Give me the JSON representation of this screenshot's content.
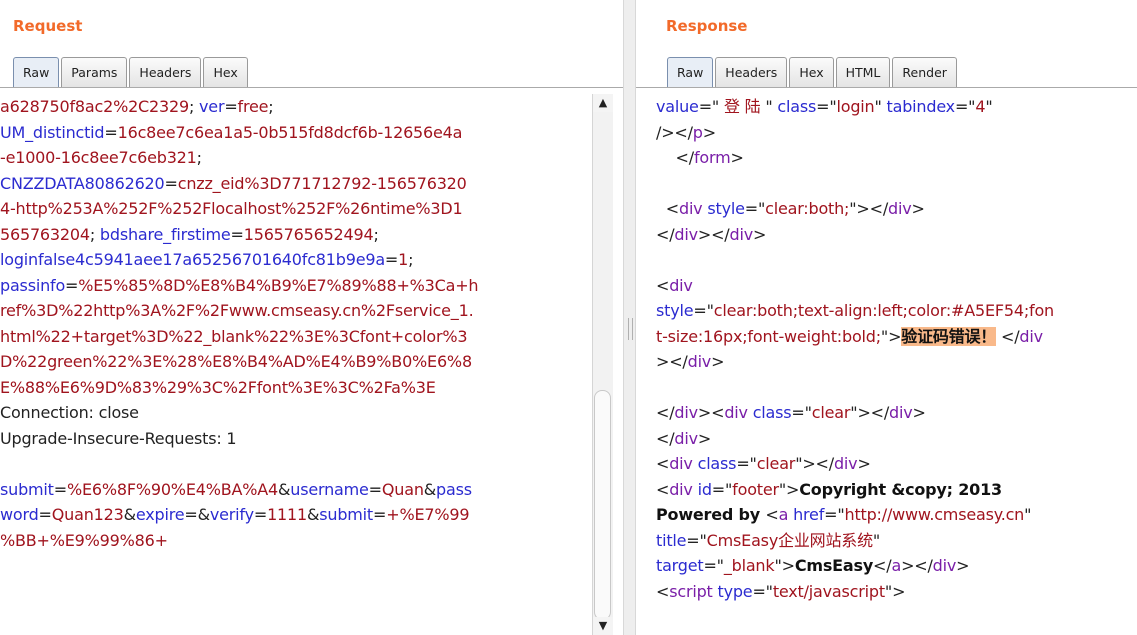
{
  "request": {
    "title": "Request",
    "tabs": [
      "Raw",
      "Params",
      "Headers",
      "Hex"
    ],
    "lines": [
      [
        [
          "v",
          "a628750f8ac2%2C2329"
        ],
        [
          "p",
          "; "
        ],
        [
          "k",
          "ver"
        ],
        [
          "p",
          "="
        ],
        [
          "v",
          "free"
        ],
        [
          "p",
          ";"
        ]
      ],
      [
        [
          "k",
          "UM_distinctid"
        ],
        [
          "p",
          "="
        ],
        [
          "v",
          "16c8ee7c6ea1a5-0b515fd8dcf6b-12656e4a"
        ]
      ],
      [
        [
          "v",
          "-e1000-16c8ee7c6eb321"
        ],
        [
          "p",
          ";"
        ]
      ],
      [
        [
          "k",
          "CNZZDATA80862620"
        ],
        [
          "p",
          "="
        ],
        [
          "v",
          "cnzz_eid%3D771712792-156576320"
        ]
      ],
      [
        [
          "v",
          "4-http%253A%252F%252Flocalhost%252F%26ntime%3D1"
        ]
      ],
      [
        [
          "v",
          "565763204"
        ],
        [
          "p",
          "; "
        ],
        [
          "k",
          "bdshare_firstime"
        ],
        [
          "p",
          "="
        ],
        [
          "v",
          "1565765652494"
        ],
        [
          "p",
          ";"
        ]
      ],
      [
        [
          "k",
          "loginfalse4c5941aee17a65256701640fc81b9e9a"
        ],
        [
          "p",
          "="
        ],
        [
          "v",
          "1"
        ],
        [
          "p",
          ";"
        ]
      ],
      [
        [
          "k",
          "passinfo"
        ],
        [
          "p",
          "="
        ],
        [
          "v",
          "%E5%85%8D%E8%B4%B9%E7%89%88+%3Ca+h"
        ]
      ],
      [
        [
          "v",
          "ref%3D%22http%3A%2F%2Fwww.cmseasy.cn%2Fservice_1."
        ]
      ],
      [
        [
          "v",
          "html%22+target%3D%22_blank%22%3E%3Cfont+color%3"
        ]
      ],
      [
        [
          "v",
          "D%22green%22%3E%28%E8%B4%AD%E4%B9%B0%E6%8"
        ]
      ],
      [
        [
          "v",
          "E%88%E6%9D%83%29%3C%2Ffont%3E%3C%2Fa%3E"
        ]
      ],
      [
        [
          "p",
          "Connection: close"
        ]
      ],
      [
        [
          "p",
          "Upgrade-Insecure-Requests: 1"
        ]
      ],
      [
        [
          "p",
          " "
        ]
      ],
      [
        [
          "k",
          "submit"
        ],
        [
          "p",
          "="
        ],
        [
          "v",
          "%E6%8F%90%E4%BA%A4"
        ],
        [
          "p",
          "&"
        ],
        [
          "k",
          "username"
        ],
        [
          "p",
          "="
        ],
        [
          "v",
          "Quan"
        ],
        [
          "p",
          "&"
        ],
        [
          "k",
          "pass"
        ]
      ],
      [
        [
          "k",
          "word"
        ],
        [
          "p",
          "="
        ],
        [
          "v",
          "Quan123"
        ],
        [
          "p",
          "&"
        ],
        [
          "k",
          "expire"
        ],
        [
          "p",
          "="
        ],
        [
          "p",
          "&"
        ],
        [
          "k",
          "verify"
        ],
        [
          "p",
          "="
        ],
        [
          "v",
          "1111"
        ],
        [
          "p",
          "&"
        ],
        [
          "k",
          "submit"
        ],
        [
          "p",
          "="
        ],
        [
          "v",
          "+%E7%99"
        ]
      ],
      [
        [
          "v",
          "%BB+%E9%99%86+"
        ]
      ]
    ]
  },
  "response": {
    "title": "Response",
    "tabs": [
      "Raw",
      "Headers",
      "Hex",
      "HTML",
      "Render"
    ],
    "lines": [
      [
        [
          "attr",
          "value"
        ],
        [
          "p",
          "=\""
        ],
        [
          "val",
          " 登 陆 "
        ],
        [
          "p",
          "\" "
        ],
        [
          "attr",
          "class"
        ],
        [
          "p",
          "=\""
        ],
        [
          "val",
          "login"
        ],
        [
          "p",
          "\" "
        ],
        [
          "attr",
          "tabindex"
        ],
        [
          "p",
          "=\""
        ],
        [
          "val",
          "4"
        ],
        [
          "p",
          "\""
        ]
      ],
      [
        [
          "p",
          "/></"
        ],
        [
          "tag",
          "p"
        ],
        [
          "p",
          ">"
        ]
      ],
      [
        [
          "p",
          "    </"
        ],
        [
          "tag",
          "form"
        ],
        [
          "p",
          ">"
        ]
      ],
      [
        [
          "p",
          " "
        ]
      ],
      [
        [
          "p",
          "  <"
        ],
        [
          "tag",
          "div"
        ],
        [
          "p",
          " "
        ],
        [
          "attr",
          "style"
        ],
        [
          "p",
          "=\""
        ],
        [
          "val",
          "clear:both;"
        ],
        [
          "p",
          "\"></"
        ],
        [
          "tag",
          "div"
        ],
        [
          "p",
          ">"
        ]
      ],
      [
        [
          "p",
          "</"
        ],
        [
          "tag",
          "div"
        ],
        [
          "p",
          "></"
        ],
        [
          "tag",
          "div"
        ],
        [
          "p",
          ">"
        ]
      ],
      [
        [
          "p",
          " "
        ]
      ],
      [
        [
          "p",
          "<"
        ],
        [
          "tag",
          "div"
        ]
      ],
      [
        [
          "attr",
          "style"
        ],
        [
          "p",
          "=\""
        ],
        [
          "val",
          "clear:both;text-align:left;color:#A5EF54;fon"
        ]
      ],
      [
        [
          "val",
          "t-size:16px;font-weight:bold;"
        ],
        [
          "p",
          "\">"
        ],
        [
          "hl",
          "验证码错误！"
        ],
        [
          "p",
          " </"
        ],
        [
          "tag",
          "div"
        ]
      ],
      [
        [
          "p",
          "></"
        ],
        [
          "tag",
          "div"
        ],
        [
          "p",
          ">"
        ]
      ],
      [
        [
          "p",
          " "
        ]
      ],
      [
        [
          "p",
          "</"
        ],
        [
          "tag",
          "div"
        ],
        [
          "p",
          "><"
        ],
        [
          "tag",
          "div"
        ],
        [
          "p",
          " "
        ],
        [
          "attr",
          "class"
        ],
        [
          "p",
          "=\""
        ],
        [
          "val",
          "clear"
        ],
        [
          "p",
          "\"></"
        ],
        [
          "tag",
          "div"
        ],
        [
          "p",
          ">"
        ]
      ],
      [
        [
          "p",
          "</"
        ],
        [
          "tag",
          "div"
        ],
        [
          "p",
          ">"
        ]
      ],
      [
        [
          "p",
          "<"
        ],
        [
          "tag",
          "div"
        ],
        [
          "p",
          " "
        ],
        [
          "attr",
          "class"
        ],
        [
          "p",
          "=\""
        ],
        [
          "val",
          "clear"
        ],
        [
          "p",
          "\"></"
        ],
        [
          "tag",
          "div"
        ],
        [
          "p",
          ">"
        ]
      ],
      [
        [
          "p",
          "<"
        ],
        [
          "tag",
          "div"
        ],
        [
          "p",
          " "
        ],
        [
          "attr",
          "id"
        ],
        [
          "p",
          "=\""
        ],
        [
          "val",
          "footer"
        ],
        [
          "p",
          "\">"
        ],
        [
          "b",
          "Copyright &copy; 2013"
        ]
      ],
      [
        [
          "b",
          "Powered by "
        ],
        [
          "p",
          "<"
        ],
        [
          "tag",
          "a"
        ],
        [
          "p",
          " "
        ],
        [
          "attr",
          "href"
        ],
        [
          "p",
          "=\""
        ],
        [
          "val",
          "http://www.cmseasy.cn"
        ],
        [
          "p",
          "\""
        ]
      ],
      [
        [
          "attr",
          "title"
        ],
        [
          "p",
          "=\""
        ],
        [
          "val",
          "CmsEasy企业网站系统"
        ],
        [
          "p",
          "\""
        ]
      ],
      [
        [
          "attr",
          "target"
        ],
        [
          "p",
          "=\""
        ],
        [
          "val",
          "_blank"
        ],
        [
          "p",
          "\">"
        ],
        [
          "b",
          "CmsEasy"
        ],
        [
          "p",
          "</"
        ],
        [
          "tag",
          "a"
        ],
        [
          "p",
          "></"
        ],
        [
          "tag",
          "div"
        ],
        [
          "p",
          ">"
        ]
      ],
      [
        [
          "p",
          "<"
        ],
        [
          "tag",
          "script"
        ],
        [
          "p",
          " "
        ],
        [
          "attr",
          "type"
        ],
        [
          "p",
          "=\""
        ],
        [
          "val",
          "text/javascript"
        ],
        [
          "p",
          "\">"
        ]
      ]
    ]
  }
}
